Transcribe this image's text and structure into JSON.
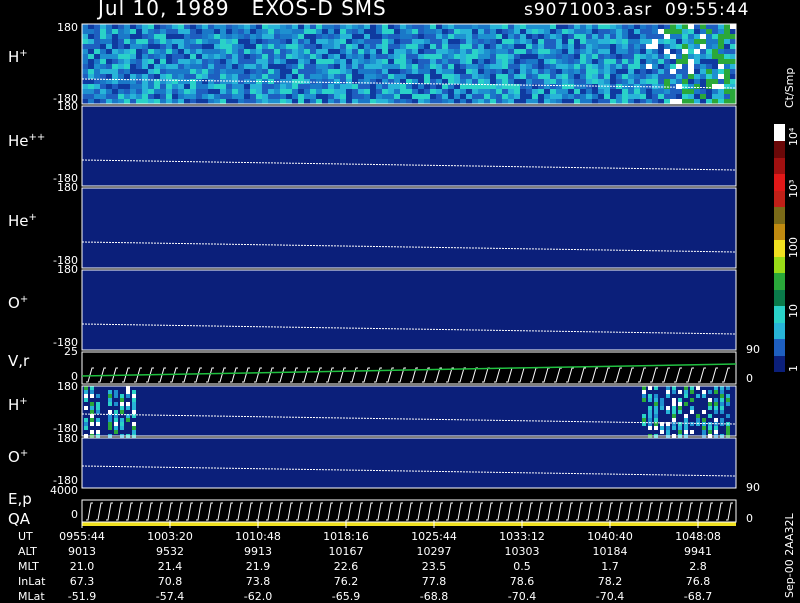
{
  "header": {
    "date_instrument": "Jul 10, 1989   EXOS-D SMS",
    "file_time": "s9071003.asr  09:55:44"
  },
  "panels": [
    {
      "label": "H",
      "sup": "+",
      "ymax": "180",
      "ymin": "-180"
    },
    {
      "label": "He",
      "sup": "++",
      "ymax": "180",
      "ymin": "-180"
    },
    {
      "label": "He",
      "sup": "+",
      "ymax": "180",
      "ymin": "-180"
    },
    {
      "label": "O",
      "sup": "+",
      "ymax": "180",
      "ymin": "-180"
    },
    {
      "label": "V,r",
      "sup": "",
      "ymax": "25",
      "ymin": "0"
    },
    {
      "label": "H",
      "sup": "+",
      "ymax": "180",
      "ymin": "-180"
    },
    {
      "label": "O",
      "sup": "+",
      "ymax": "180",
      "ymin": "-180"
    },
    {
      "label": "E,p",
      "sup": "",
      "ymax": "4000",
      "ymin": "0"
    }
  ],
  "qa_label": "QA",
  "right_axis": {
    "v_top": "90",
    "v_bot": "0",
    "e_top": "90",
    "e_bot": "0"
  },
  "colorbar": {
    "unit": "Ct/Smp",
    "ticks": [
      "1",
      "10",
      "100",
      "10³",
      "10⁴"
    ],
    "colors": [
      "#0b1f7a",
      "#1e5fc0",
      "#28b4d8",
      "#2ad2c8",
      "#0a7a4a",
      "#2aa83a",
      "#9adc18",
      "#f0e020",
      "#c08a10",
      "#7a6a18",
      "#c02018",
      "#e01818",
      "#a01010",
      "#6a0808",
      "#ffffff"
    ]
  },
  "time_axis": {
    "ticks": [
      "0955:44",
      "1003:20",
      "1010:48",
      "1018:16",
      "1025:44",
      "1033:12",
      "1040:40",
      "1048:08"
    ]
  },
  "ephemeris": {
    "rows": [
      {
        "label": "UT",
        "values": [
          "0955:44",
          "1003:20",
          "1010:48",
          "1018:16",
          "1025:44",
          "1033:12",
          "1040:40",
          "1048:08"
        ]
      },
      {
        "label": "ALT",
        "values": [
          "9013",
          "9532",
          "9913",
          "10167",
          "10297",
          "10303",
          "10184",
          "9941"
        ]
      },
      {
        "label": "MLT",
        "values": [
          "21.0",
          "21.4",
          "21.9",
          "22.6",
          "23.5",
          "0.5",
          "1.7",
          "2.8"
        ]
      },
      {
        "label": "InLat",
        "values": [
          "67.3",
          "70.8",
          "73.8",
          "76.2",
          "77.8",
          "78.6",
          "78.2",
          "76.8"
        ]
      },
      {
        "label": "MLat",
        "values": [
          "-51.9",
          "-57.4",
          "-62.0",
          "-65.9",
          "-68.8",
          "-70.4",
          "-70.4",
          "-68.7"
        ]
      }
    ]
  },
  "footer_code": "Sep-00  2AA32L",
  "chart_data": {
    "type": "heatmap",
    "title": "Jul 10, 1989   EXOS-D SMS",
    "xlabel": "UT",
    "x_ticks": [
      "0955:44",
      "1003:20",
      "1010:48",
      "1018:16",
      "1025:44",
      "1033:12",
      "1040:40",
      "1048:08"
    ],
    "series": [
      {
        "name": "H+",
        "ylim": [
          -180,
          180
        ]
      },
      {
        "name": "He++",
        "ylim": [
          -180,
          180
        ]
      },
      {
        "name": "He+",
        "ylim": [
          -180,
          180
        ]
      },
      {
        "name": "O+",
        "ylim": [
          -180,
          180
        ]
      },
      {
        "name": "V,r",
        "ylim": [
          0,
          25
        ]
      },
      {
        "name": "H+",
        "ylim": [
          -180,
          180
        ]
      },
      {
        "name": "O+",
        "ylim": [
          -180,
          180
        ]
      },
      {
        "name": "E,p",
        "ylim": [
          0,
          4000
        ]
      }
    ],
    "colorbar_unit": "Ct/Smp",
    "colorbar_ticks": [
      "1",
      "10",
      "100",
      "10³",
      "10⁴"
    ]
  }
}
